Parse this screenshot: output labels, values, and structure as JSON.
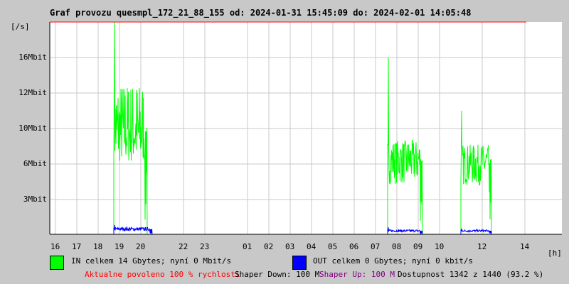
{
  "chart_data": {
    "type": "line",
    "title": "Graf provozu quesmpl_172_21_88_155 od: 2024-01-31 15:45:09 do: 2024-02-01 14:05:48",
    "ylabel": "[/s]",
    "xlabel": "[h]",
    "y_ticks": [
      {
        "label": "3Mbit",
        "value": 3
      },
      {
        "label": "6Mbit",
        "value": 6
      },
      {
        "label": "10Mbit",
        "value": 10
      },
      {
        "label": "12Mbit",
        "value": 12
      },
      {
        "label": "16Mbit",
        "value": 16
      }
    ],
    "x_ticks": [
      {
        "label": "16",
        "h": 0
      },
      {
        "label": "17",
        "h": 1
      },
      {
        "label": "18",
        "h": 2
      },
      {
        "label": "19",
        "h": 3
      },
      {
        "label": "20",
        "h": 4
      },
      {
        "label": "22",
        "h": 6
      },
      {
        "label": "23",
        "h": 7
      },
      {
        "label": "01",
        "h": 9
      },
      {
        "label": "02",
        "h": 10
      },
      {
        "label": "03",
        "h": 11
      },
      {
        "label": "04",
        "h": 12
      },
      {
        "label": "05",
        "h": 13
      },
      {
        "label": "06",
        "h": 14
      },
      {
        "label": "07",
        "h": 15
      },
      {
        "label": "08",
        "h": 16
      },
      {
        "label": "09",
        "h": 17
      },
      {
        "label": "10",
        "h": 18
      },
      {
        "label": "12",
        "h": 20
      },
      {
        "label": "14",
        "h": 22
      }
    ],
    "x_range_hours_from_16h": [
      -0.25,
      23.7
    ],
    "y_max": 19.5,
    "grid": true,
    "series": [
      {
        "name": "IN",
        "color": "#00ff00",
        "segments": [
          {
            "start": 2.73,
            "end": 4.28,
            "mean": 9.5,
            "noise": 3.5,
            "spike": 19.5
          },
          {
            "start": 15.57,
            "end": 17.17,
            "mean": 6.5,
            "noise": 2.2,
            "spike": 16
          },
          {
            "start": 19.0,
            "end": 20.4,
            "mean": 6.2,
            "noise": 2.0,
            "spike": 11
          }
        ]
      },
      {
        "name": "OUT",
        "color": "#0000ff",
        "segments": [
          {
            "start": 2.73,
            "end": 4.5,
            "mean": 0.45,
            "noise": 0.15,
            "spike": 0.8
          },
          {
            "start": 15.57,
            "end": 17.17,
            "mean": 0.3,
            "noise": 0.1,
            "spike": 0.6
          },
          {
            "start": 19.0,
            "end": 20.4,
            "mean": 0.3,
            "noise": 0.1,
            "spike": 0.5
          }
        ]
      }
    ]
  },
  "legend": {
    "in_label": "IN celkem 14 Gbytes; nyní 0 Mbit/s",
    "out_label": "OUT celkem 0 Gbytes; nyní 0 kbit/s",
    "in_color": "#00ff00",
    "out_color": "#0000ff"
  },
  "status": {
    "allowed": "Aktualne povoleno 100 % rychlosti",
    "shaper_down": "Shaper Down: 100 M",
    "shaper_up": "Shaper Up: 100 M",
    "availability": "Dostupnost 1342 z 1440 (93.2 %)"
  }
}
